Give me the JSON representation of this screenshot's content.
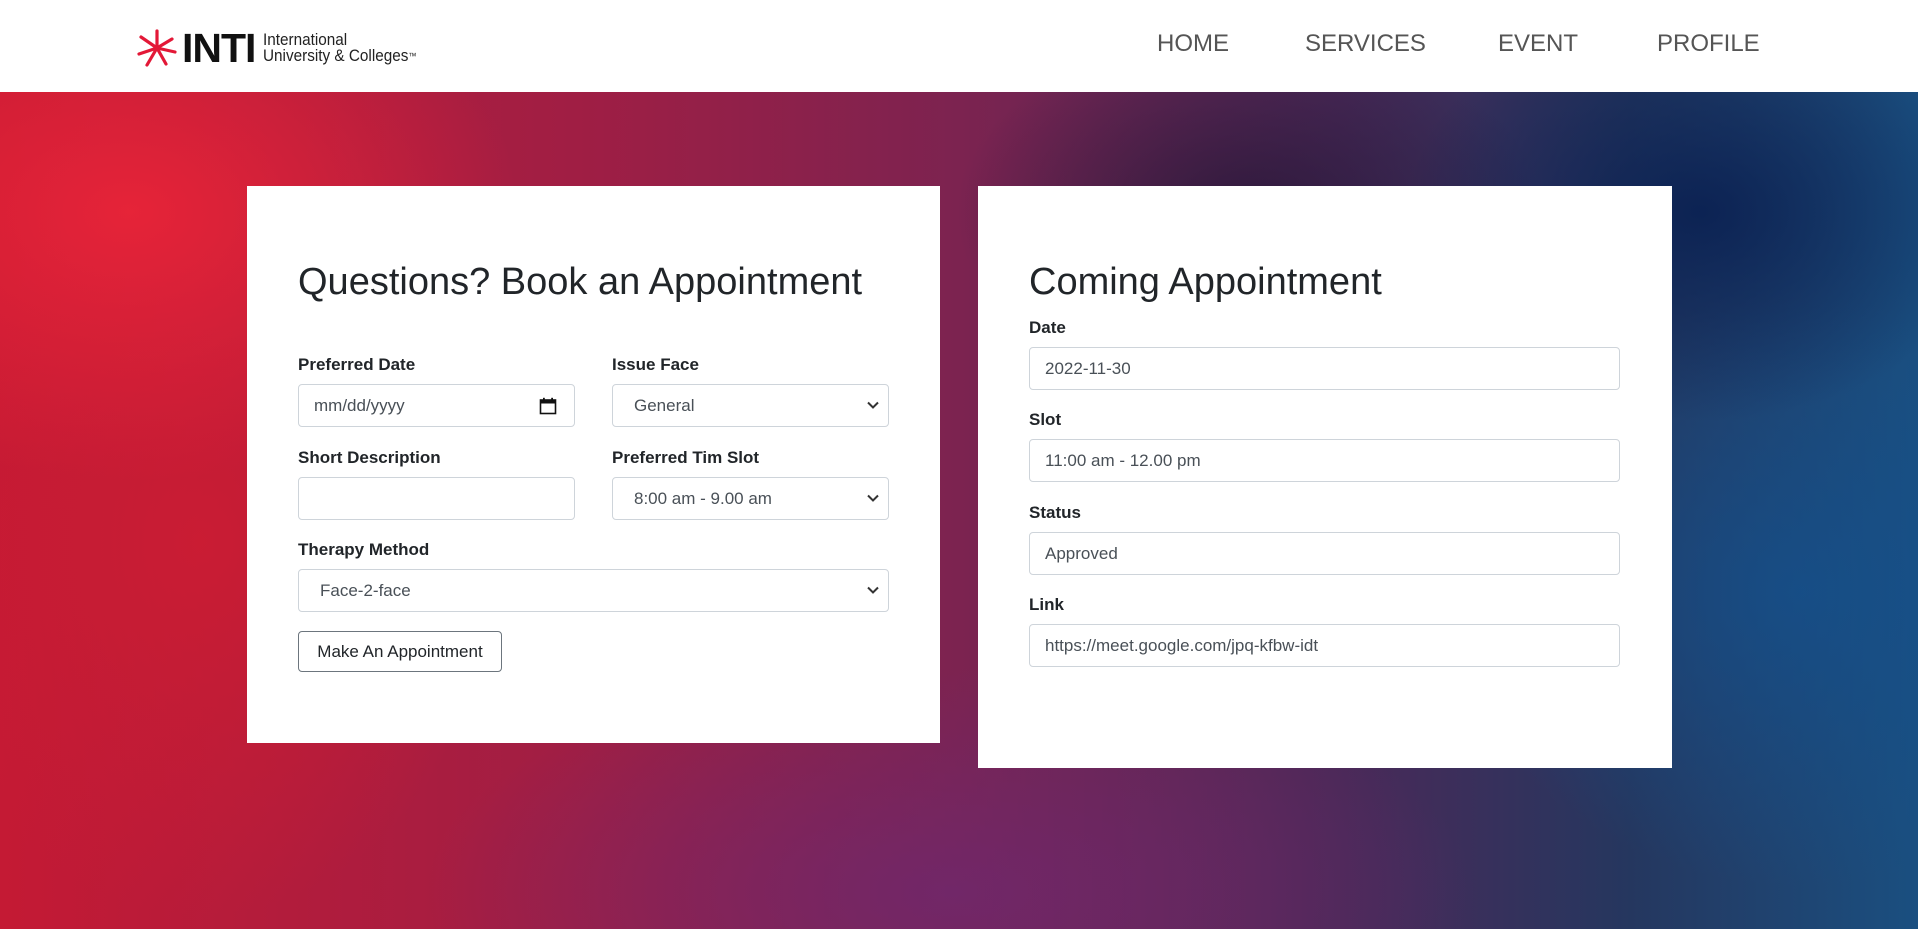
{
  "brand": {
    "logo_text": "INTI",
    "logo_sub_line1": "International",
    "logo_sub_line2": "University & Colleges",
    "logo_tm": "™",
    "accent_color": "#e31837"
  },
  "nav": {
    "items": [
      {
        "label": "HOME"
      },
      {
        "label": "SERVICES"
      },
      {
        "label": "EVENT"
      },
      {
        "label": "PROFILE"
      }
    ]
  },
  "booking": {
    "title": "Questions? Book an Appointment",
    "preferred_date_label": "Preferred Date",
    "preferred_date_placeholder": "mm/dd/yyyy",
    "issue_face_label": "Issue Face",
    "issue_face_value": "General",
    "short_description_label": "Short Description",
    "short_description_value": "",
    "time_slot_label": "Preferred Tim Slot",
    "time_slot_value": "8:00 am - 9.00 am",
    "therapy_method_label": "Therapy Method",
    "therapy_method_value": "Face-2-face",
    "submit_label": "Make An Appointment"
  },
  "upcoming": {
    "title": "Coming Appointment",
    "date_label": "Date",
    "date_value": "2022-11-30",
    "slot_label": "Slot",
    "slot_value": "11:00 am - 12.00 pm",
    "status_label": "Status",
    "status_value": "Approved",
    "link_label": "Link",
    "link_value": "https://meet.google.com/jpq-kfbw-idt"
  }
}
